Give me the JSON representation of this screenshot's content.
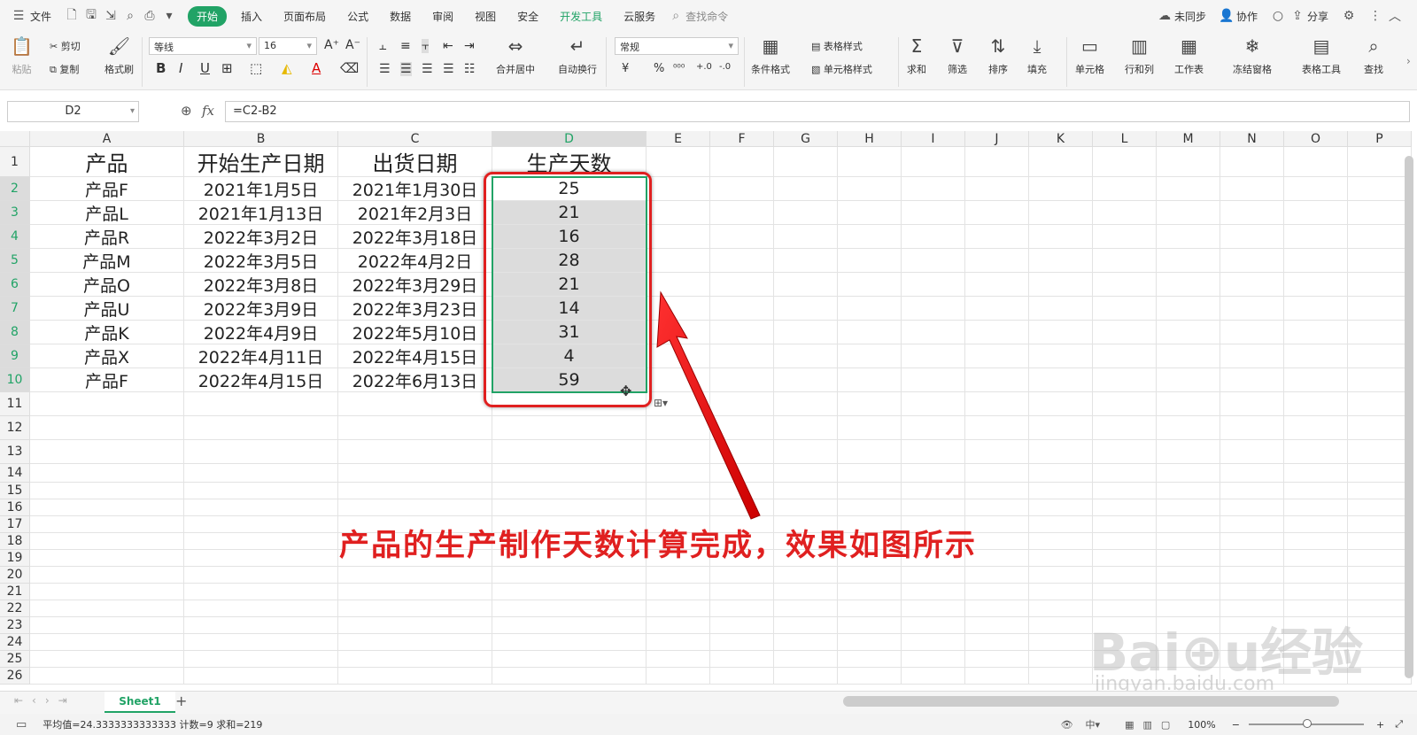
{
  "menubar": {
    "file": "文件",
    "tabs": [
      "开始",
      "插入",
      "页面布局",
      "公式",
      "数据",
      "审阅",
      "视图",
      "安全",
      "开发工具",
      "云服务"
    ],
    "search": "查找命令",
    "sync": "未同步",
    "collab": "协作",
    "share": "分享"
  },
  "ribbon": {
    "paste": "粘贴",
    "cut": "剪切",
    "copy": "复制",
    "format_painter": "格式刷",
    "font_name": "等线",
    "font_size": "16",
    "merge": "合并居中",
    "wrap": "自动换行",
    "number_format": "常规",
    "cond_format": "条件格式",
    "table_style": "表格样式",
    "cell_style": "单元格样式",
    "sum": "求和",
    "filter": "筛选",
    "sort": "排序",
    "fill": "填充",
    "cell": "单元格",
    "rowcol": "行和列",
    "worksheet": "工作表",
    "freeze": "冻结窗格",
    "table_tool": "表格工具",
    "find": "查找"
  },
  "formula_bar": {
    "name_box": "D2",
    "fx": "fx",
    "formula": "=C2-B2"
  },
  "columns": [
    "A",
    "B",
    "C",
    "D",
    "E",
    "F",
    "G",
    "H",
    "I",
    "J",
    "K",
    "L",
    "M",
    "N",
    "O",
    "P"
  ],
  "rows": [
    "1",
    "2",
    "3",
    "4",
    "5",
    "6",
    "7",
    "8",
    "9",
    "10",
    "11",
    "12",
    "13",
    "14",
    "15",
    "16",
    "17",
    "18",
    "19",
    "20",
    "21",
    "22",
    "23",
    "24",
    "25",
    "26"
  ],
  "table": {
    "headers": [
      "产品",
      "开始生产日期",
      "出货日期",
      "生产天数"
    ],
    "data": [
      [
        "产品F",
        "2021年1月5日",
        "2021年1月30日",
        "25"
      ],
      [
        "产品L",
        "2021年1月13日",
        "2021年2月3日",
        "21"
      ],
      [
        "产品R",
        "2022年3月2日",
        "2022年3月18日",
        "16"
      ],
      [
        "产品M",
        "2022年3月5日",
        "2022年4月2日",
        "28"
      ],
      [
        "产品O",
        "2022年3月8日",
        "2022年3月29日",
        "21"
      ],
      [
        "产品U",
        "2022年3月9日",
        "2022年3月23日",
        "14"
      ],
      [
        "产品K",
        "2022年4月9日",
        "2022年5月10日",
        "31"
      ],
      [
        "产品X",
        "2022年4月11日",
        "2022年4月15日",
        "4"
      ],
      [
        "产品F",
        "2022年4月15日",
        "2022年6月13日",
        "59"
      ]
    ]
  },
  "annotation": "产品的生产制作天数计算完成，效果如图所示",
  "watermark": "Baidu经验 jingyan.baidu.com",
  "sheet_tab": "Sheet1",
  "status": {
    "stats": "平均值=24.3333333333333  计数=9  求和=219",
    "zoom": "100%"
  },
  "colors": {
    "accent": "#21a366",
    "annotation": "#e02020"
  }
}
